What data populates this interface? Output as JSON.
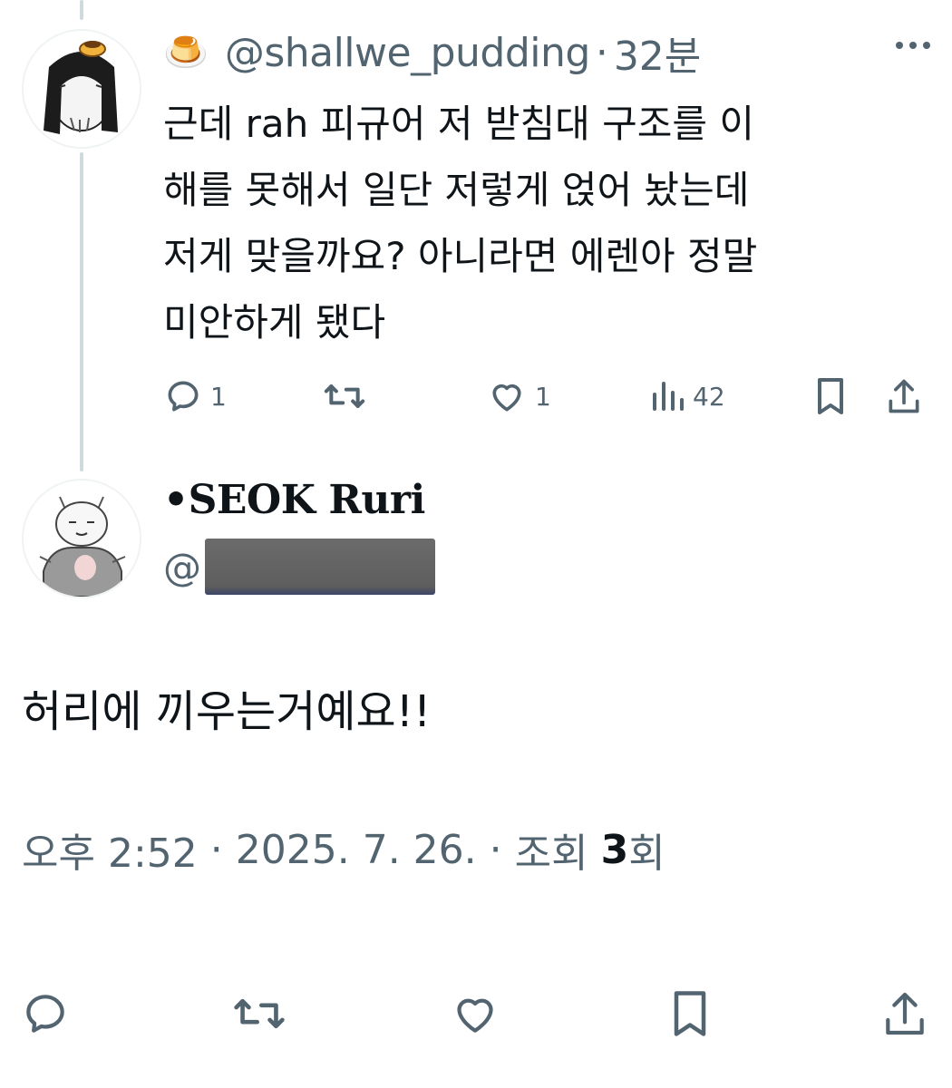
{
  "reply": {
    "name_icon": "🍮",
    "handle": "@shallwe_pudding",
    "separator": "·",
    "time": "32분",
    "text_lines": [
      "근데 rah 피규어 저 받침대 구조를 이",
      "해를 못해서 일단 저렇게 얹어 놨는데",
      "저게 맞을까요? 아니라면 에렌아 정말",
      "미안하게 됐다"
    ],
    "reply_count": "1",
    "like_count": "1",
    "view_count": "42"
  },
  "main": {
    "display_name": "•SEOK Ruri",
    "handle_prefix": "@",
    "text": "허리에 끼우는거예요!!",
    "time": "오후 2:52",
    "separator": "·",
    "date": "2025. 7. 26.",
    "views_label": "조회",
    "views_count": "3",
    "views_suffix": "회"
  },
  "icons": {
    "reply": "reply-icon",
    "retweet": "retweet-icon",
    "like": "heart-icon",
    "views": "views-icon",
    "bookmark": "bookmark-icon",
    "share": "share-icon",
    "more": "more-icon"
  },
  "colors": {
    "text": "#0f1419",
    "secondary": "#536471",
    "thread_line": "#cfd9de"
  }
}
